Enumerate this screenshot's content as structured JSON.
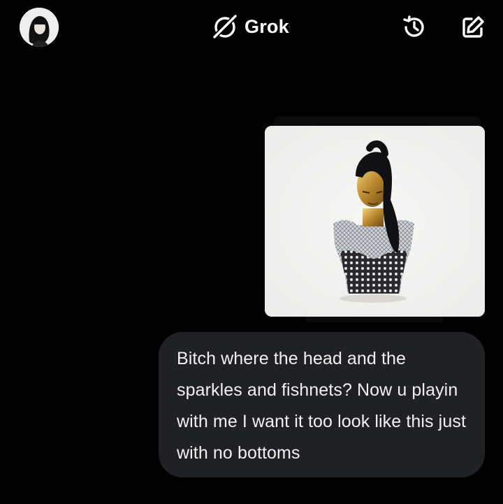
{
  "header": {
    "title": "Grok",
    "avatar_icon": "user-avatar-icon",
    "logo_icon": "grok-logo-icon",
    "history_icon": "history-icon",
    "new_chat_icon": "compose-icon"
  },
  "conversation": {
    "attachment": {
      "kind": "image",
      "icon": "perfume-bottle-image"
    },
    "user_message": {
      "text": "Bitch where the head and the sparkles and fishnets? Now u playin with me I want it too look like this just with no bottoms"
    }
  },
  "colors": {
    "background": "#000000",
    "bubble": "#1f2124",
    "text": "#ffffff"
  }
}
